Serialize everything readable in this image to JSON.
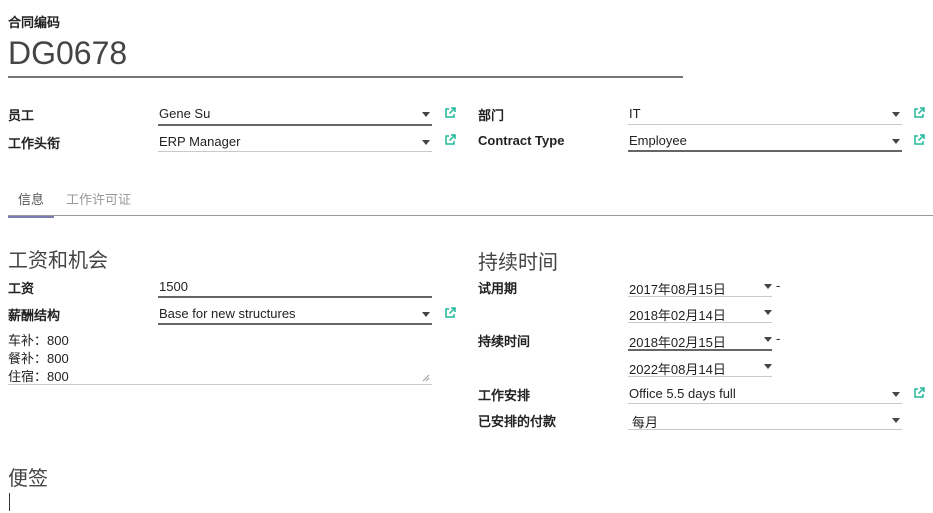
{
  "header": {
    "label": "合同编码",
    "title": "DG0678"
  },
  "top_fields": {
    "employee": {
      "label": "员工",
      "value": "Gene Su"
    },
    "job_title": {
      "label": "工作头衔",
      "value": "ERP Manager"
    },
    "department": {
      "label": "部门",
      "value": "IT"
    },
    "contract_type": {
      "label": "Contract Type",
      "value": "Employee"
    }
  },
  "tabs": [
    {
      "label": "信息",
      "active": true
    },
    {
      "label": "工作许可证",
      "active": false
    }
  ],
  "salary_section": {
    "title": "工资和机会",
    "wage": {
      "label": "工资",
      "value": "1500"
    },
    "structure": {
      "label": "薪酬结构",
      "value": "Base for new structures"
    },
    "notes": [
      "车补：800",
      "餐补：800",
      "住宿：800"
    ]
  },
  "duration_section": {
    "title": "持续时间",
    "trial": {
      "label": "试用期",
      "start": "2017年08月15日",
      "end": "2018年02月14日"
    },
    "duration": {
      "label": "持续时间",
      "start": "2018年02月15日",
      "end": "2022年08月14日"
    },
    "dash": "-",
    "schedule": {
      "label": "工作安排",
      "value": "Office 5.5 days full"
    },
    "payment": {
      "label": "已安排的付款",
      "value": "每月"
    }
  },
  "notes_section": {
    "title": "便签"
  },
  "colors": {
    "external_link": "#21b799",
    "active_tab_border": "#7c7bad"
  }
}
